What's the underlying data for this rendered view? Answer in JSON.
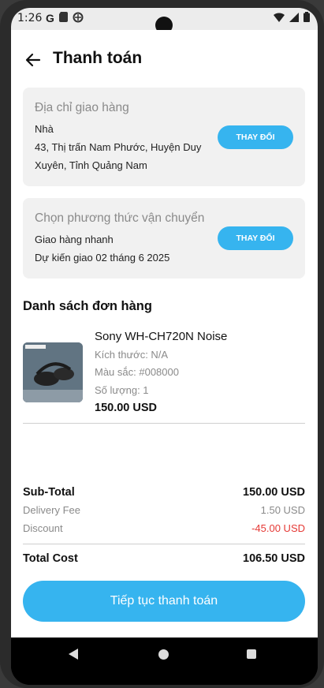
{
  "status_bar": {
    "time": "1:26",
    "left_icons": [
      "G",
      "sd-card-icon",
      "data-saver-icon"
    ],
    "right_icons": [
      "wifi-icon",
      "signal-icon",
      "battery-icon"
    ]
  },
  "header": {
    "title": "Thanh toán"
  },
  "shipping_address": {
    "title": "Địa chỉ giao hàng",
    "label": "Nhà",
    "address_line1": "43, Thị trấn Nam Phước, Huyện Duy",
    "address_line2": "Xuyên, Tỉnh Quảng Nam",
    "change_label": "THAY ĐỔI"
  },
  "shipping_method": {
    "title": "Chọn phương thức vận chuyển",
    "method": "Giao hàng nhanh",
    "eta": "Dự kiến giao 02 tháng 6 2025",
    "change_label": "THAY ĐỔI"
  },
  "orders": {
    "title": "Danh sách đơn hàng",
    "items": [
      {
        "name": "Sony WH-CH720N Noise",
        "size": "Kích thước: N/A",
        "color": "Màu sắc: #008000",
        "quantity": "Số lượng: 1",
        "price": "150.00 USD"
      }
    ]
  },
  "summary": {
    "subtotal_label": "Sub-Total",
    "subtotal_value": "150.00 USD",
    "delivery_label": "Delivery Fee",
    "delivery_value": "1.50 USD",
    "discount_label": "Discount",
    "discount_value": "-45.00 USD",
    "total_label": "Total Cost",
    "total_value": "106.50 USD"
  },
  "cta": {
    "label": "Tiếp tục thanh toán"
  },
  "colors": {
    "accent": "#36b4ef",
    "discount": "#e53935",
    "card_bg": "#f1f1f1"
  }
}
